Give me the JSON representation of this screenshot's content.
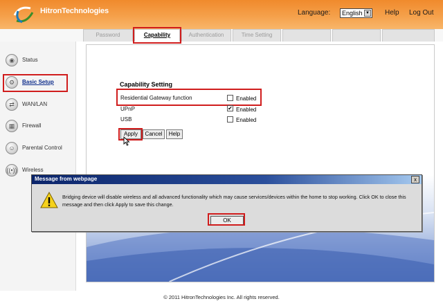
{
  "header": {
    "brand": "HitronTechnologies",
    "language_label": "Language:",
    "language_value": "English",
    "help_label": "Help",
    "logout_label": "Log Out"
  },
  "tabs": [
    {
      "label": "Password",
      "active": false
    },
    {
      "label": "Capability",
      "active": true
    },
    {
      "label": "Authentication",
      "active": false
    },
    {
      "label": "Time Setting",
      "active": false
    },
    {
      "label": "",
      "active": false
    },
    {
      "label": "",
      "active": false
    },
    {
      "label": "",
      "active": false
    }
  ],
  "sidebar": {
    "items": [
      {
        "label": "Status",
        "icon": "status-icon",
        "active": false
      },
      {
        "label": "Basic Setup",
        "icon": "basic-setup-icon",
        "active": true
      },
      {
        "label": "WAN/LAN",
        "icon": "wan-lan-icon",
        "active": false
      },
      {
        "label": "Firewall",
        "icon": "firewall-icon",
        "active": false
      },
      {
        "label": "Parental Control",
        "icon": "parental-control-icon",
        "active": false
      },
      {
        "label": "Wireless",
        "icon": "wireless-icon",
        "active": false
      }
    ]
  },
  "capability": {
    "title": "Capability Setting",
    "rows": [
      {
        "label": "Residential Gateway function",
        "checked": false,
        "option": "Enabled"
      },
      {
        "label": "UPnP",
        "checked": true,
        "option": "Enabled"
      },
      {
        "label": "USB",
        "checked": false,
        "option": "Enabled"
      }
    ],
    "buttons": {
      "apply": "Apply",
      "cancel": "Cancel",
      "help": "Help"
    }
  },
  "dialog": {
    "title": "Message from webpage",
    "message": "Bridging device will disable wireless and all advanced functionality which may cause services/devices within the home to stop working. Click OK to close this message and then click Apply to save this change.",
    "ok_label": "OK",
    "close_symbol": "x"
  },
  "footer": {
    "copyright": "© 2011 HitronTechnologies Inc. All rights reserved."
  },
  "colors": {
    "header_orange": "#f08a2c",
    "highlight_red": "#d01c1c",
    "dialog_titlebar": "#0a246a",
    "active_nav": "#0a2a8a"
  }
}
